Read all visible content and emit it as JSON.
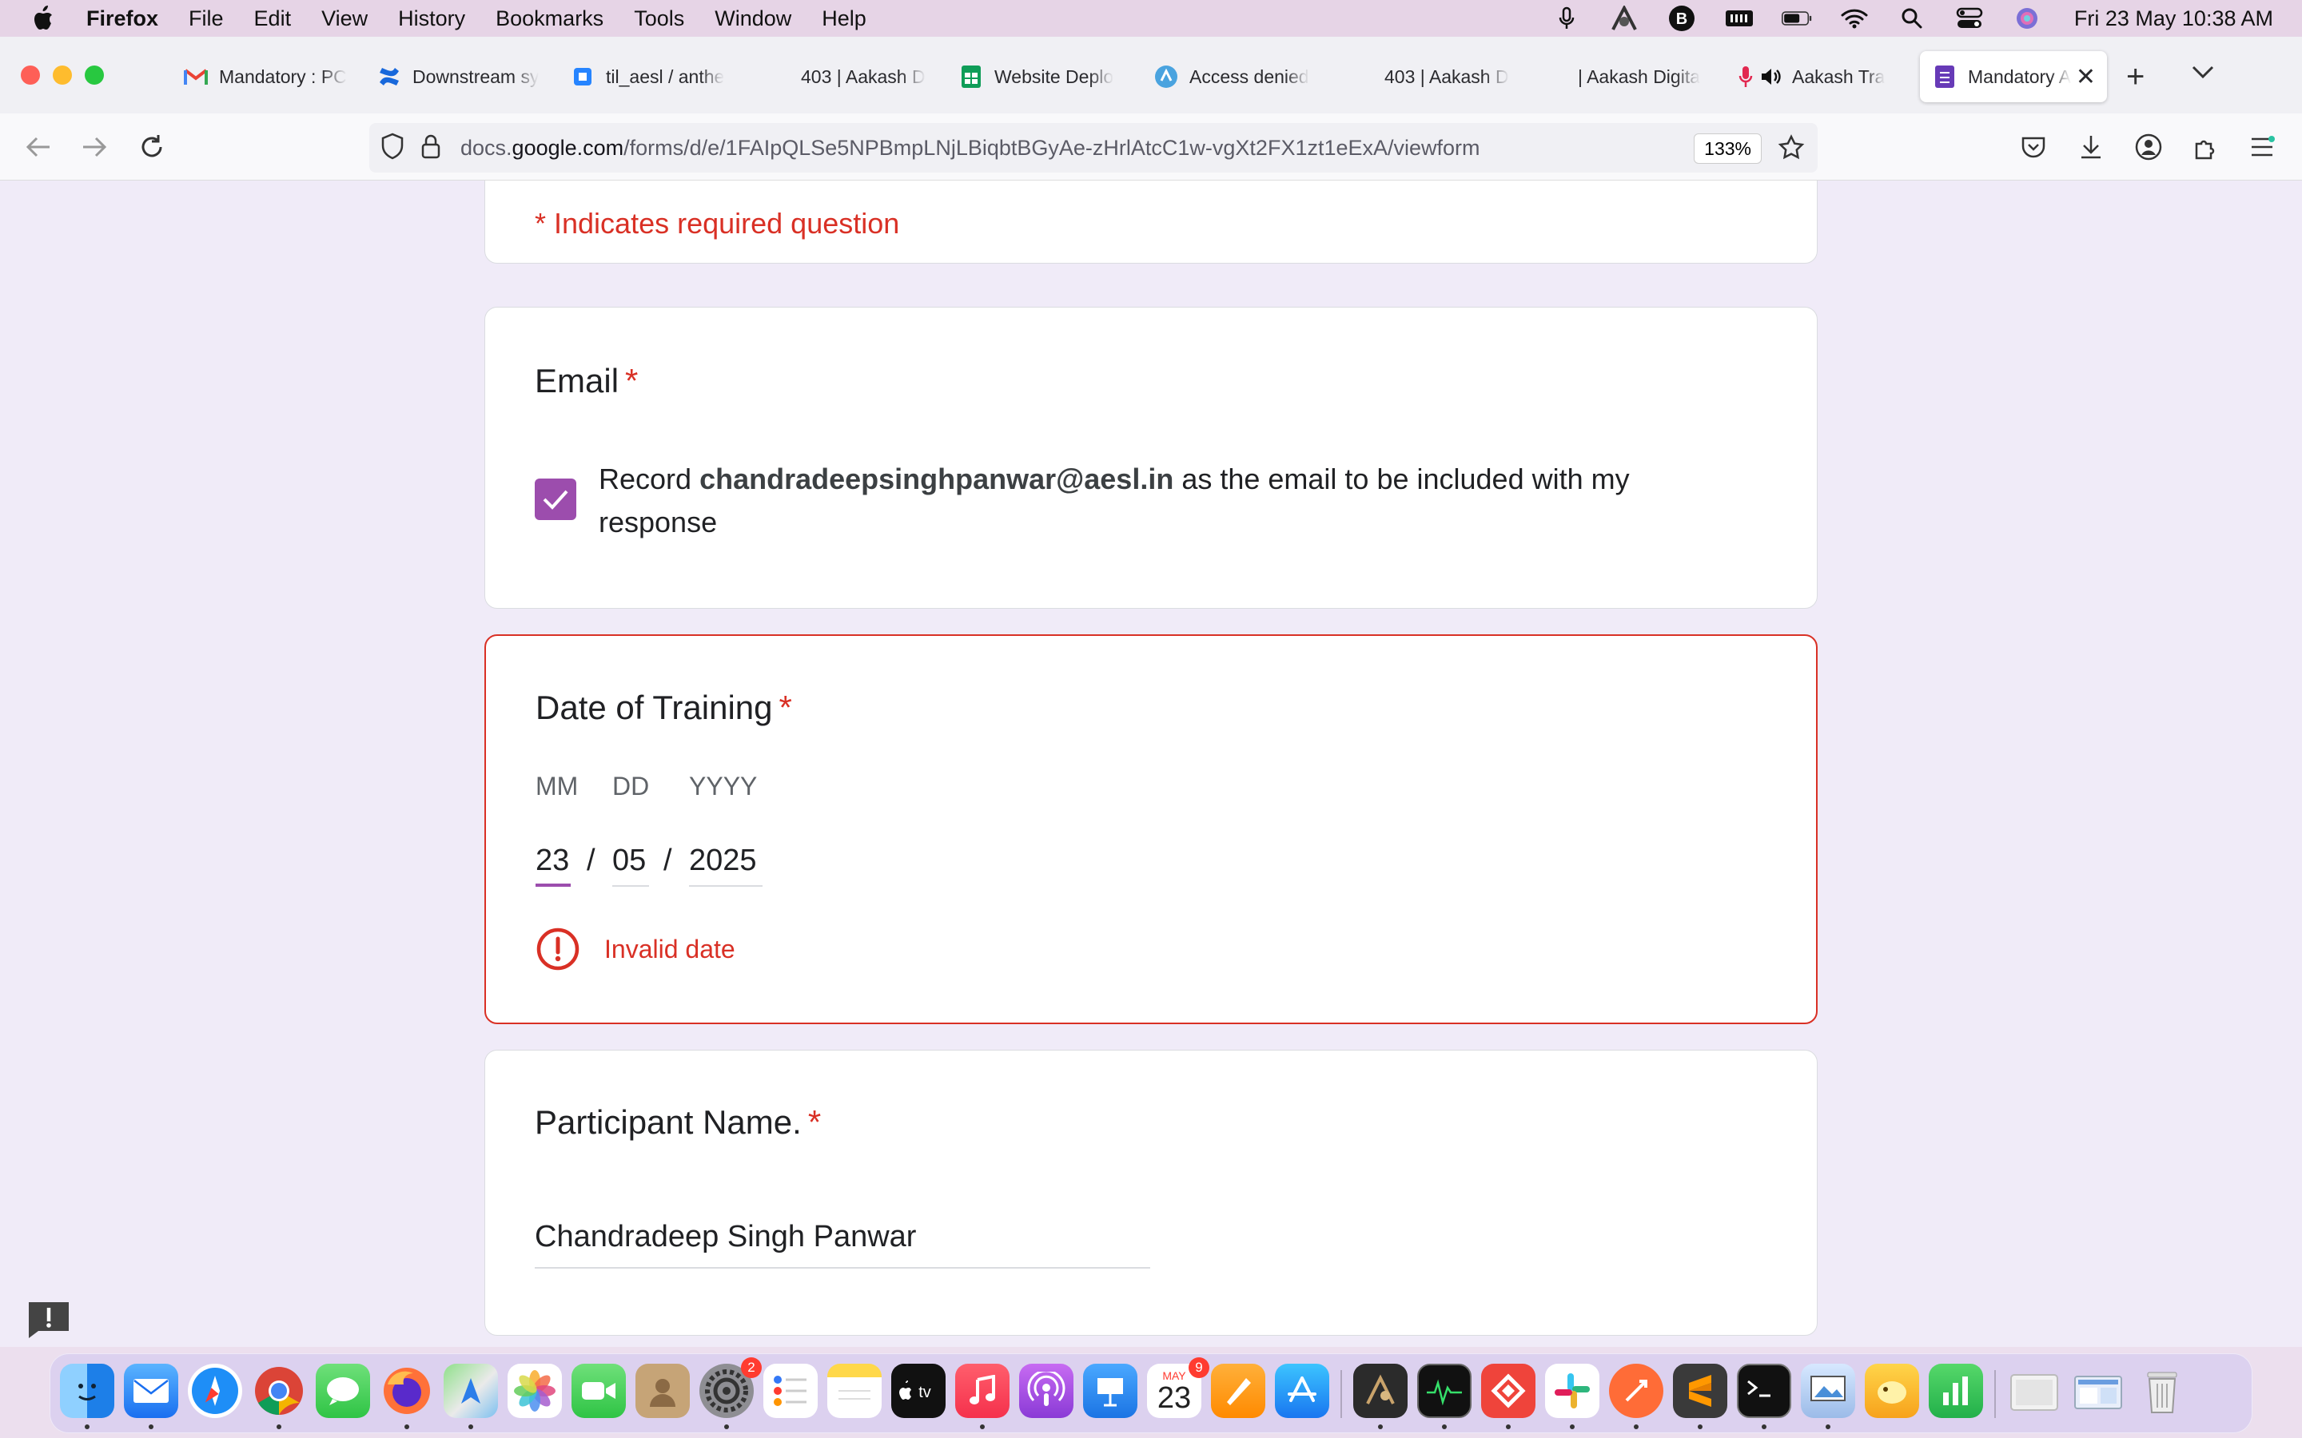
{
  "menubar": {
    "app_name": "Firefox",
    "items": [
      "File",
      "Edit",
      "View",
      "History",
      "Bookmarks",
      "Tools",
      "Window",
      "Help"
    ],
    "clock": "Fri 23 May  10:38 AM"
  },
  "tabs": [
    {
      "label": "Mandatory : PC",
      "icon": "gmail-icon"
    },
    {
      "label": "Downstream sy",
      "icon": "confluence-icon"
    },
    {
      "label": "til_aesl / anthe",
      "icon": "jira-icon"
    },
    {
      "label": "403 | Aakash D",
      "icon": "none"
    },
    {
      "label": "Website Deplo",
      "icon": "sheets-icon"
    },
    {
      "label": "Access denied",
      "icon": "globe-icon"
    },
    {
      "label": "403 | Aakash D",
      "icon": "none"
    },
    {
      "label": "| Aakash Digita",
      "icon": "none"
    },
    {
      "label": "Aakash Tra",
      "icon": "mic-icon"
    },
    {
      "label": "Mandatory A",
      "icon": "forms-icon",
      "active": true
    }
  ],
  "navbar": {
    "url_prefix": "docs.",
    "url_domain": "google.com",
    "url_path": "/forms/d/e/1FAIpQLSe5NPBmpLNjLBiqbtBGyAe-zHrlAtcC1w-vgXt2FX1zt1eExA/viewform",
    "zoom": "133%"
  },
  "form": {
    "required_note": "* Indicates required question",
    "email": {
      "title": "Email",
      "required_mark": "*",
      "checked": true,
      "text_before": "Record ",
      "email": "chandradeepsinghpanwar@aesl.in",
      "text_after": " as the email to be included with my response"
    },
    "date": {
      "title": "Date of Training",
      "required_mark": "*",
      "labels": {
        "mm": "MM",
        "dd": "DD",
        "yyyy": "YYYY"
      },
      "values": {
        "mm": "23",
        "dd": "05",
        "yyyy": "2025"
      },
      "separator": "/",
      "error": "Invalid date"
    },
    "participant": {
      "title": "Participant Name.",
      "required_mark": "*",
      "value": "Chandradeep Singh Panwar"
    }
  },
  "dock": {
    "apps": [
      "Finder",
      "Mail",
      "Safari",
      "Chrome",
      "Messages",
      "Firefox",
      "Maps",
      "Photos",
      "FaceTime",
      "Contacts",
      "System Settings",
      "Reminders",
      "Notes",
      "TV",
      "Music",
      "Podcasts",
      "Keynote",
      "Calendar",
      "Pages",
      "App Store",
      "Script Editor",
      "Activity Monitor",
      "AnyDesk",
      "Slack",
      "Postman",
      "Sublime Text",
      "Terminal",
      "Preview",
      "Tableplus",
      "Numbers",
      "Downloads",
      "Screenshots",
      "Trash"
    ],
    "settings_badge": "2",
    "calendar_month": "MAY",
    "calendar_day": "23",
    "calendar_badge": "9"
  }
}
